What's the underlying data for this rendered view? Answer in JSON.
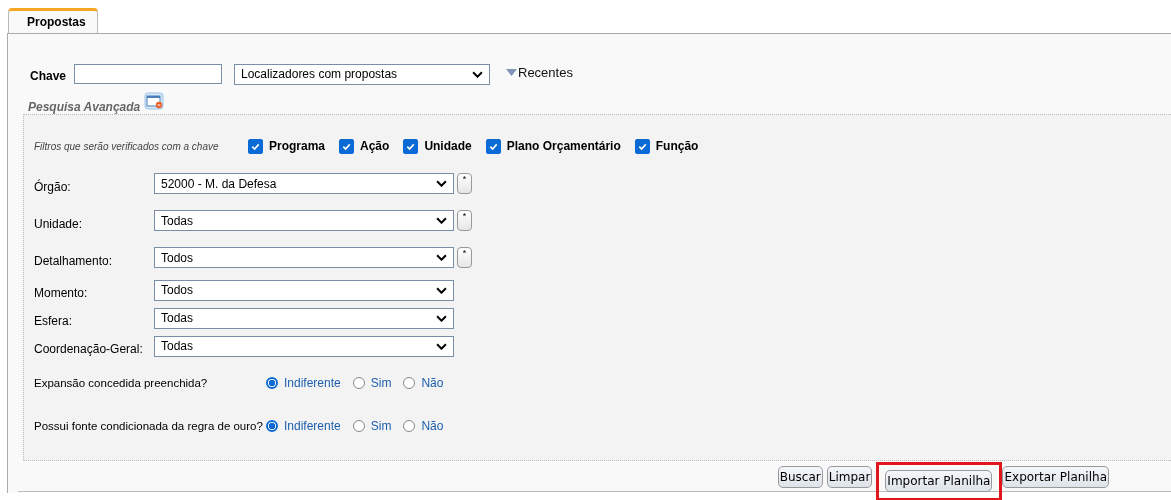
{
  "tabs": [
    {
      "label": "Propostas",
      "selected": true
    }
  ],
  "search": {
    "label": "Chave",
    "scope": "Localizadores com propostas",
    "recent": "Recentes"
  },
  "advanced": {
    "title": "Pesquisa Avançada",
    "filters_hint": "Filtros que serão verificados com a chave",
    "filters": [
      {
        "label": "Programa",
        "checked": true
      },
      {
        "label": "Ação",
        "checked": true
      },
      {
        "label": "Unidade",
        "checked": true
      },
      {
        "label": "Plano Orçamentário",
        "checked": true
      },
      {
        "label": "Função",
        "checked": true
      }
    ],
    "fields": [
      {
        "label": "Órgão:",
        "value": "52000 - M. da Defesa",
        "reset": "*"
      },
      {
        "label": "Unidade:",
        "value": "Todas",
        "reset": "*"
      },
      {
        "label": "Detalhamento:",
        "value": "Todos",
        "reset": "*"
      },
      {
        "label": "Momento:",
        "value": "Todos"
      },
      {
        "label": "Esfera:",
        "value": "Todas"
      },
      {
        "label": "Coordenação-Geral:",
        "value": "Todas"
      }
    ],
    "questions": [
      {
        "label": "Expansão concedida preenchida?",
        "options": [
          {
            "label": "Indiferente",
            "selected": true
          },
          {
            "label": "Sim",
            "selected": false
          },
          {
            "label": "Não",
            "selected": false
          }
        ]
      },
      {
        "label": "Possui fonte condicionada da regra de ouro?",
        "options": [
          {
            "label": "Indiferente",
            "selected": true
          },
          {
            "label": "Sim",
            "selected": false
          },
          {
            "label": "Não",
            "selected": false
          }
        ]
      }
    ]
  },
  "buttons": [
    {
      "label": "Buscar",
      "highlighted": false
    },
    {
      "label": "Limpar",
      "highlighted": false
    },
    {
      "label": "Importar Planilha",
      "highlighted": true
    },
    {
      "label": "Exportar Planilha",
      "highlighted": false
    }
  ]
}
